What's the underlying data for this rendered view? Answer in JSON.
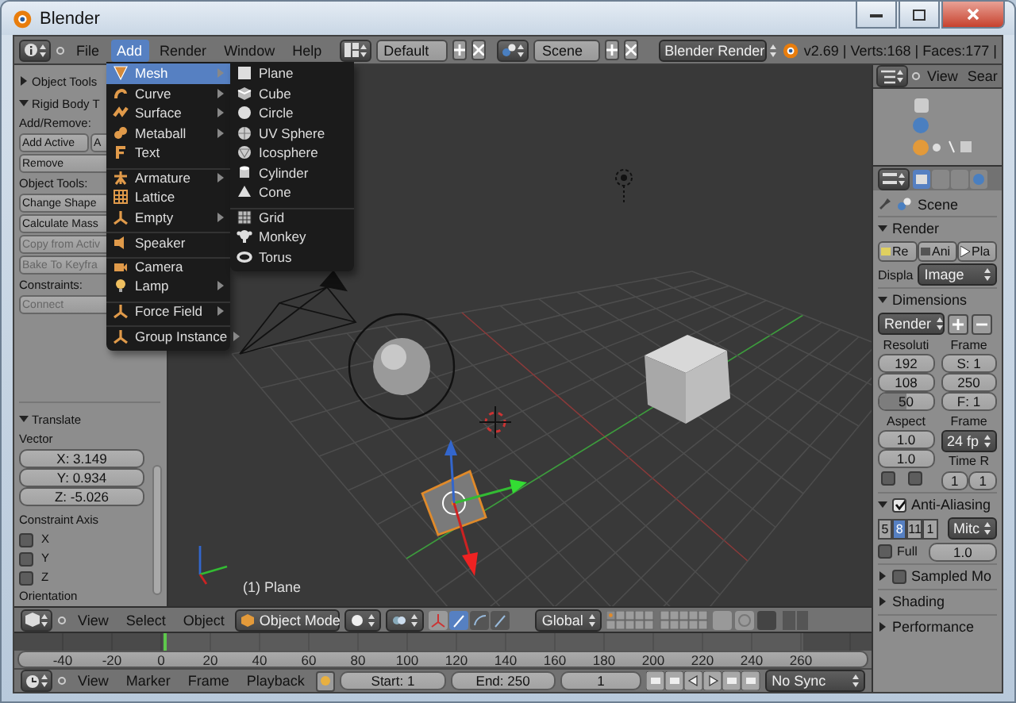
{
  "window": {
    "title": "Blender"
  },
  "menubar": {
    "menus": [
      {
        "label": "File",
        "selected": false
      },
      {
        "label": "Add",
        "selected": true
      },
      {
        "label": "Render",
        "selected": false
      },
      {
        "label": "Window",
        "selected": false
      },
      {
        "label": "Help",
        "selected": false
      }
    ],
    "layout": "Default",
    "scene": "Scene",
    "engine": "Blender Render",
    "stats": "v2.69 | Verts:168 | Faces:177 |"
  },
  "tool_shelf": {
    "rows": [
      {
        "kind": "header",
        "label": "Object Tools",
        "expanded": false
      },
      {
        "kind": "header",
        "label": "Rigid Body T",
        "expanded": true
      },
      {
        "kind": "label",
        "label": "Add/Remove:"
      },
      {
        "kind": "buttons",
        "buttons": [
          {
            "label": "Add Active",
            "disabled": false
          },
          {
            "label": "A",
            "disabled": false
          }
        ]
      },
      {
        "kind": "buttons",
        "buttons": [
          {
            "label": "Remove",
            "disabled": false
          }
        ]
      },
      {
        "kind": "label",
        "label": "Object Tools:"
      },
      {
        "kind": "buttons",
        "buttons": [
          {
            "label": "Change Shape",
            "disabled": false
          }
        ]
      },
      {
        "kind": "buttons",
        "buttons": [
          {
            "label": "Calculate Mass",
            "disabled": false
          }
        ]
      },
      {
        "kind": "buttons",
        "buttons": [
          {
            "label": "Copy from Activ",
            "disabled": true
          }
        ]
      },
      {
        "kind": "buttons",
        "buttons": [
          {
            "label": "Bake To Keyfra",
            "disabled": true
          }
        ]
      },
      {
        "kind": "label",
        "label": "Constraints:"
      },
      {
        "kind": "buttons",
        "buttons": [
          {
            "label": "Connect",
            "disabled": true
          }
        ]
      }
    ]
  },
  "operator_panel": {
    "rows": [
      {
        "kind": "header",
        "label": "Translate",
        "expanded": true
      },
      {
        "kind": "label",
        "label": "Vector"
      },
      {
        "kind": "vector",
        "fields": [
          "X: 3.149",
          "Y: 0.934",
          "Z: -5.026"
        ]
      },
      {
        "kind": "label",
        "label": "Constraint Axis"
      },
      {
        "kind": "checkbox",
        "label": "X",
        "checked": false
      },
      {
        "kind": "checkbox",
        "label": "Y",
        "checked": false
      },
      {
        "kind": "checkbox",
        "label": "Z",
        "checked": false
      },
      {
        "kind": "label",
        "label": "Orientation"
      }
    ]
  },
  "add_menu": {
    "items": [
      {
        "label": "Mesh",
        "selected": true,
        "submenu": true,
        "separator_before": false
      },
      {
        "label": "Curve",
        "selected": false,
        "submenu": true,
        "separator_before": false
      },
      {
        "label": "Surface",
        "selected": false,
        "submenu": true,
        "separator_before": false
      },
      {
        "label": "Metaball",
        "selected": false,
        "submenu": true,
        "separator_before": false
      },
      {
        "label": "Text",
        "selected": false,
        "submenu": false,
        "separator_before": false
      },
      {
        "label": "Armature",
        "selected": false,
        "submenu": true,
        "separator_before": true
      },
      {
        "label": "Lattice",
        "selected": false,
        "submenu": false,
        "separator_before": false
      },
      {
        "label": "Empty",
        "selected": false,
        "submenu": true,
        "separator_before": false
      },
      {
        "label": "Speaker",
        "selected": false,
        "submenu": false,
        "separator_before": true
      },
      {
        "label": "Camera",
        "selected": false,
        "submenu": false,
        "separator_before": true
      },
      {
        "label": "Lamp",
        "selected": false,
        "submenu": true,
        "separator_before": false
      },
      {
        "label": "Force Field",
        "selected": false,
        "submenu": true,
        "separator_before": true
      },
      {
        "label": "Group Instance",
        "selected": false,
        "submenu": true,
        "separator_before": true
      }
    ]
  },
  "mesh_menu": {
    "items": [
      {
        "label": "Plane",
        "separator_before": false
      },
      {
        "label": "Cube",
        "separator_before": false
      },
      {
        "label": "Circle",
        "separator_before": false
      },
      {
        "label": "UV Sphere",
        "separator_before": false
      },
      {
        "label": "Icosphere",
        "separator_before": false
      },
      {
        "label": "Cylinder",
        "separator_before": false
      },
      {
        "label": "Cone",
        "separator_before": false
      },
      {
        "label": "Grid",
        "separator_before": true
      },
      {
        "label": "Monkey",
        "separator_before": false
      },
      {
        "label": "Torus",
        "separator_before": false
      }
    ]
  },
  "viewport": {
    "object_label": "(1) Plane",
    "header": {
      "menus": [
        "View",
        "Select",
        "Object"
      ],
      "mode": "Object Mode",
      "orientation": "Global"
    }
  },
  "timeline": {
    "ticks": [
      "-40",
      "-20",
      "0",
      "20",
      "40",
      "60",
      "80",
      "100",
      "120",
      "140",
      "160",
      "180",
      "200",
      "220",
      "240",
      "260"
    ],
    "header": {
      "menus": [
        "View",
        "Marker",
        "Frame",
        "Playback"
      ],
      "start": "Start: 1",
      "end": "End: 250",
      "current": "1",
      "sync": "No Sync"
    }
  },
  "outliner": {
    "menus": [
      "View",
      "Sear"
    ]
  },
  "properties": {
    "rows": [
      {
        "kind": "context",
        "label": "Scene"
      },
      {
        "kind": "header",
        "label": "Render",
        "expanded": true
      },
      {
        "kind": "buttons",
        "buttons": [
          {
            "label": "Re"
          },
          {
            "label": "Ani"
          },
          {
            "label": "Pla"
          }
        ]
      },
      {
        "kind": "dropdown_row",
        "label": "Displa",
        "value": "Image"
      },
      {
        "kind": "header",
        "label": "Dimensions",
        "expanded": true
      },
      {
        "kind": "preset",
        "value": "Render"
      },
      {
        "kind": "columns",
        "columns": [
          [
            {
              "kind": "label",
              "text": "Resoluti"
            },
            {
              "kind": "field",
              "value": "192"
            },
            {
              "kind": "field",
              "value": "108"
            },
            {
              "kind": "slider",
              "value": "50",
              "level": 0.5
            }
          ],
          [
            {
              "kind": "label",
              "text": "Frame"
            },
            {
              "kind": "field",
              "value": "S: 1"
            },
            {
              "kind": "field",
              "value": "250"
            },
            {
              "kind": "field",
              "value": "F: 1"
            }
          ]
        ]
      },
      {
        "kind": "columns",
        "columns": [
          [
            {
              "kind": "label",
              "text": "Aspect"
            },
            {
              "kind": "field",
              "value": "1.0"
            },
            {
              "kind": "field",
              "value": "1.0"
            },
            {
              "kind": "checks",
              "checks": [
                {
                  "checked": false
                },
                {
                  "checked": false
                }
              ]
            }
          ],
          [
            {
              "kind": "label",
              "text": "Frame"
            },
            {
              "kind": "dropdown",
              "value": "24 fp"
            },
            {
              "kind": "label",
              "text": "Time R"
            },
            {
              "kind": "pair",
              "values": [
                "1",
                "1"
              ]
            }
          ]
        ]
      },
      {
        "kind": "check_header",
        "label": "Anti-Aliasing",
        "expanded": true,
        "checked": true
      },
      {
        "kind": "samples",
        "samples": [
          {
            "label": "5",
            "selected": false
          },
          {
            "label": "8",
            "selected": true
          },
          {
            "label": "11",
            "selected": false
          },
          {
            "label": "1",
            "selected": false
          }
        ],
        "filter": "Mitc"
      },
      {
        "kind": "check_field",
        "label": "Full",
        "checked": false,
        "value": "1.0"
      },
      {
        "kind": "check_header",
        "label": "Sampled Mo",
        "expanded": false,
        "checked": false
      },
      {
        "kind": "header",
        "label": "Shading",
        "expanded": false
      },
      {
        "kind": "header",
        "label": "Performance",
        "expanded": false
      }
    ]
  }
}
